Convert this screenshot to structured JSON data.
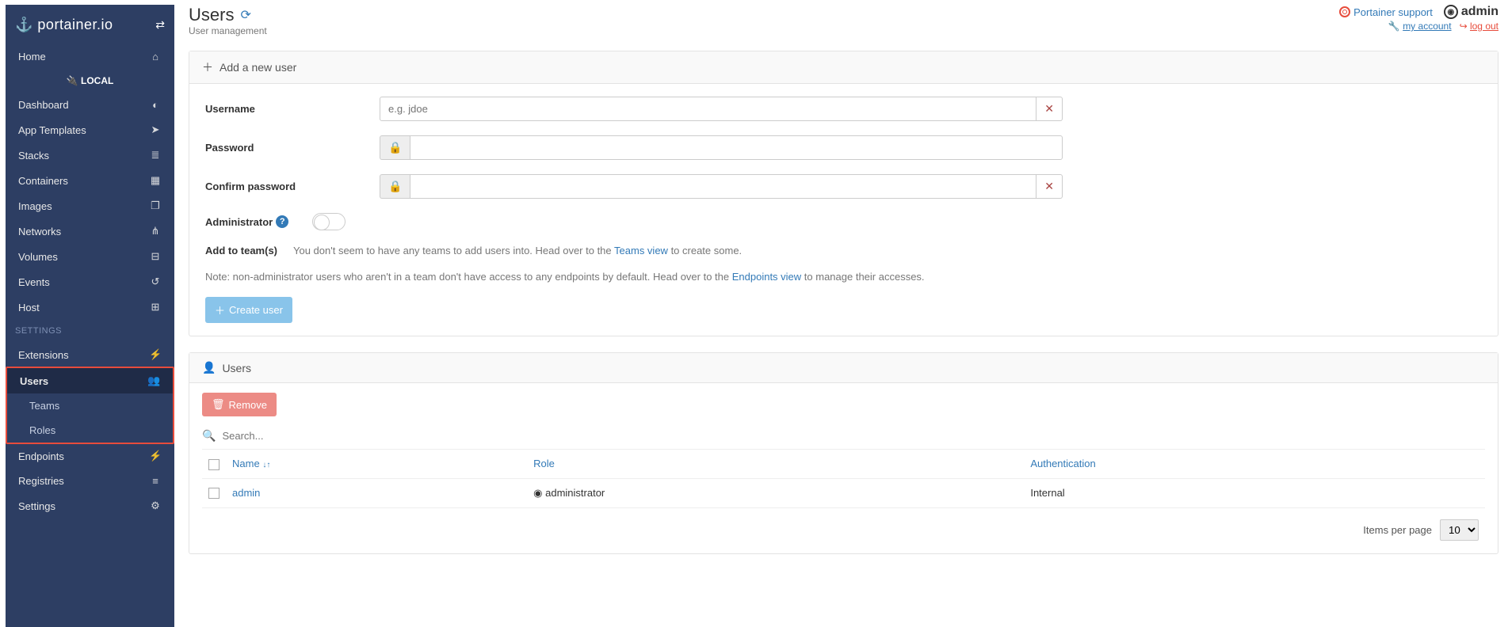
{
  "brand": {
    "name": "portainer.io"
  },
  "sidebar": {
    "home": "Home",
    "local": "LOCAL",
    "items": [
      {
        "label": "Dashboard",
        "icon": "tachometer"
      },
      {
        "label": "App Templates",
        "icon": "rocket"
      },
      {
        "label": "Stacks",
        "icon": "list"
      },
      {
        "label": "Containers",
        "icon": "cubes"
      },
      {
        "label": "Images",
        "icon": "clone"
      },
      {
        "label": "Networks",
        "icon": "sitemap"
      },
      {
        "label": "Volumes",
        "icon": "hdd"
      },
      {
        "label": "Events",
        "icon": "history"
      },
      {
        "label": "Host",
        "icon": "th"
      }
    ],
    "settings_header": "SETTINGS",
    "settings": [
      {
        "label": "Extensions",
        "icon": "bolt"
      },
      {
        "label": "Users",
        "icon": "users",
        "active": true,
        "children": [
          "Teams",
          "Roles"
        ]
      },
      {
        "label": "Endpoints",
        "icon": "plug"
      },
      {
        "label": "Registries",
        "icon": "database"
      },
      {
        "label": "Settings",
        "icon": "cogs"
      }
    ]
  },
  "header": {
    "title": "Users",
    "subtitle": "User management",
    "support": "Portainer support",
    "username": "admin",
    "my_account": "my account",
    "log_out": "log out"
  },
  "form": {
    "panel_title": "Add a new user",
    "username_label": "Username",
    "username_placeholder": "e.g. jdoe",
    "password_label": "Password",
    "confirm_label": "Confirm password",
    "admin_label": "Administrator",
    "add_team_label": "Add to team(s)",
    "no_teams_text_1": "You don't seem to have any teams to add users into. Head over to the ",
    "teams_link": "Teams view",
    "no_teams_text_2": " to create some.",
    "note_prefix": "Note: non-administrator users who aren't in a team don't have access to any endpoints by default. Head over to the ",
    "endpoints_link": "Endpoints view",
    "note_suffix": " to manage their accesses.",
    "create_btn": "Create user"
  },
  "users_panel": {
    "title": "Users",
    "remove_btn": "Remove",
    "search_placeholder": "Search...",
    "cols": {
      "name": "Name",
      "role": "Role",
      "auth": "Authentication"
    },
    "rows": [
      {
        "name": "admin",
        "role": "administrator",
        "auth": "Internal"
      }
    ],
    "items_per_page_label": "Items per page",
    "items_per_page_value": "10"
  }
}
